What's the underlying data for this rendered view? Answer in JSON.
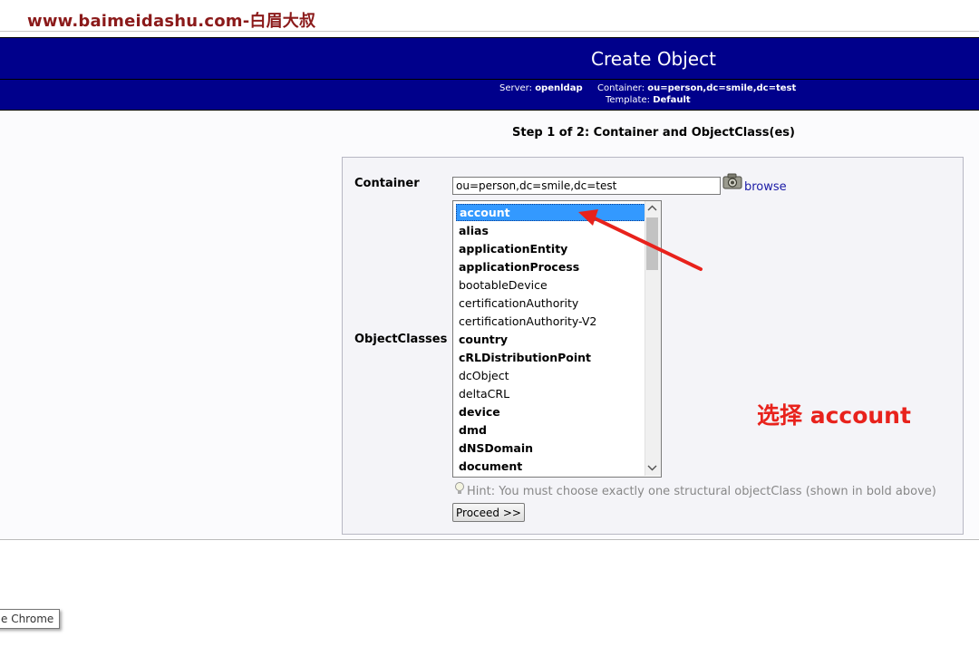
{
  "watermark": "www.baimeidashu.com-白眉大叔",
  "header": {
    "title": "Create Object",
    "server_label": "Server:",
    "server_value": "openldap",
    "container_label": "Container:",
    "container_value": "ou=person,dc=smile,dc=test",
    "template_label": "Template:",
    "template_value": "Default"
  },
  "step_title": "Step 1 of 2: Container and ObjectClass(es)",
  "form": {
    "container_label": "Container",
    "container_value": "ou=person,dc=smile,dc=test",
    "browse_label": "browse",
    "objectclasses_label": "ObjectClasses",
    "objectclasses": [
      {
        "name": "account",
        "structural": true,
        "selected": true
      },
      {
        "name": "alias",
        "structural": true,
        "selected": false
      },
      {
        "name": "applicationEntity",
        "structural": true,
        "selected": false
      },
      {
        "name": "applicationProcess",
        "structural": true,
        "selected": false
      },
      {
        "name": "bootableDevice",
        "structural": false,
        "selected": false
      },
      {
        "name": "certificationAuthority",
        "structural": false,
        "selected": false
      },
      {
        "name": "certificationAuthority-V2",
        "structural": false,
        "selected": false
      },
      {
        "name": "country",
        "structural": true,
        "selected": false
      },
      {
        "name": "cRLDistributionPoint",
        "structural": true,
        "selected": false
      },
      {
        "name": "dcObject",
        "structural": false,
        "selected": false
      },
      {
        "name": "deltaCRL",
        "structural": false,
        "selected": false
      },
      {
        "name": "device",
        "structural": true,
        "selected": false
      },
      {
        "name": "dmd",
        "structural": true,
        "selected": false
      },
      {
        "name": "dNSDomain",
        "structural": true,
        "selected": false
      },
      {
        "name": "document",
        "structural": true,
        "selected": false
      }
    ],
    "hint": "Hint: You must choose exactly one structural objectClass (shown in bold above)",
    "proceed_label": "Proceed >>"
  },
  "annotation": "选择 account",
  "tooltip": "e Chrome",
  "colors": {
    "header_bg": "#00008b",
    "selection_bg": "#3399ff",
    "annotation_red": "#e8221c",
    "watermark": "#8b1a1a"
  }
}
